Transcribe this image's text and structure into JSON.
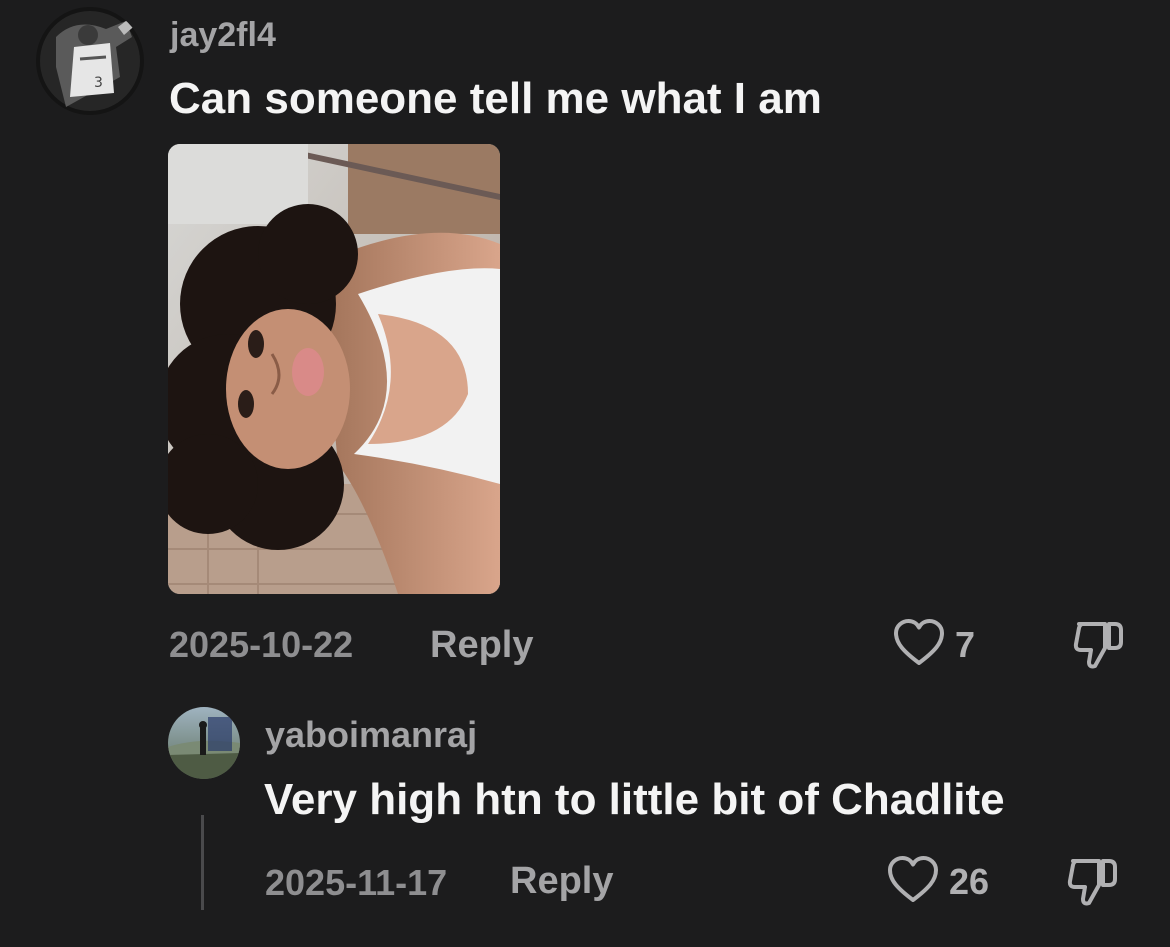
{
  "comments": [
    {
      "username": "jay2fl4",
      "text": "Can someone tell me what I am",
      "date": "2025-10-22",
      "reply_label": "Reply",
      "likes": "7"
    },
    {
      "username": "yaboimanraj",
      "text": "Very high htn to little bit of Chadlite",
      "date": "2025-11-17",
      "reply_label": "Reply",
      "likes": "26"
    }
  ],
  "icons": {
    "like": "heart-outline-icon",
    "dislike": "thumbs-down-icon"
  },
  "colors": {
    "background": "#1c1c1d",
    "username": "#a4a4a6",
    "text": "#f4f4f4",
    "meta": "#8e8e90"
  }
}
